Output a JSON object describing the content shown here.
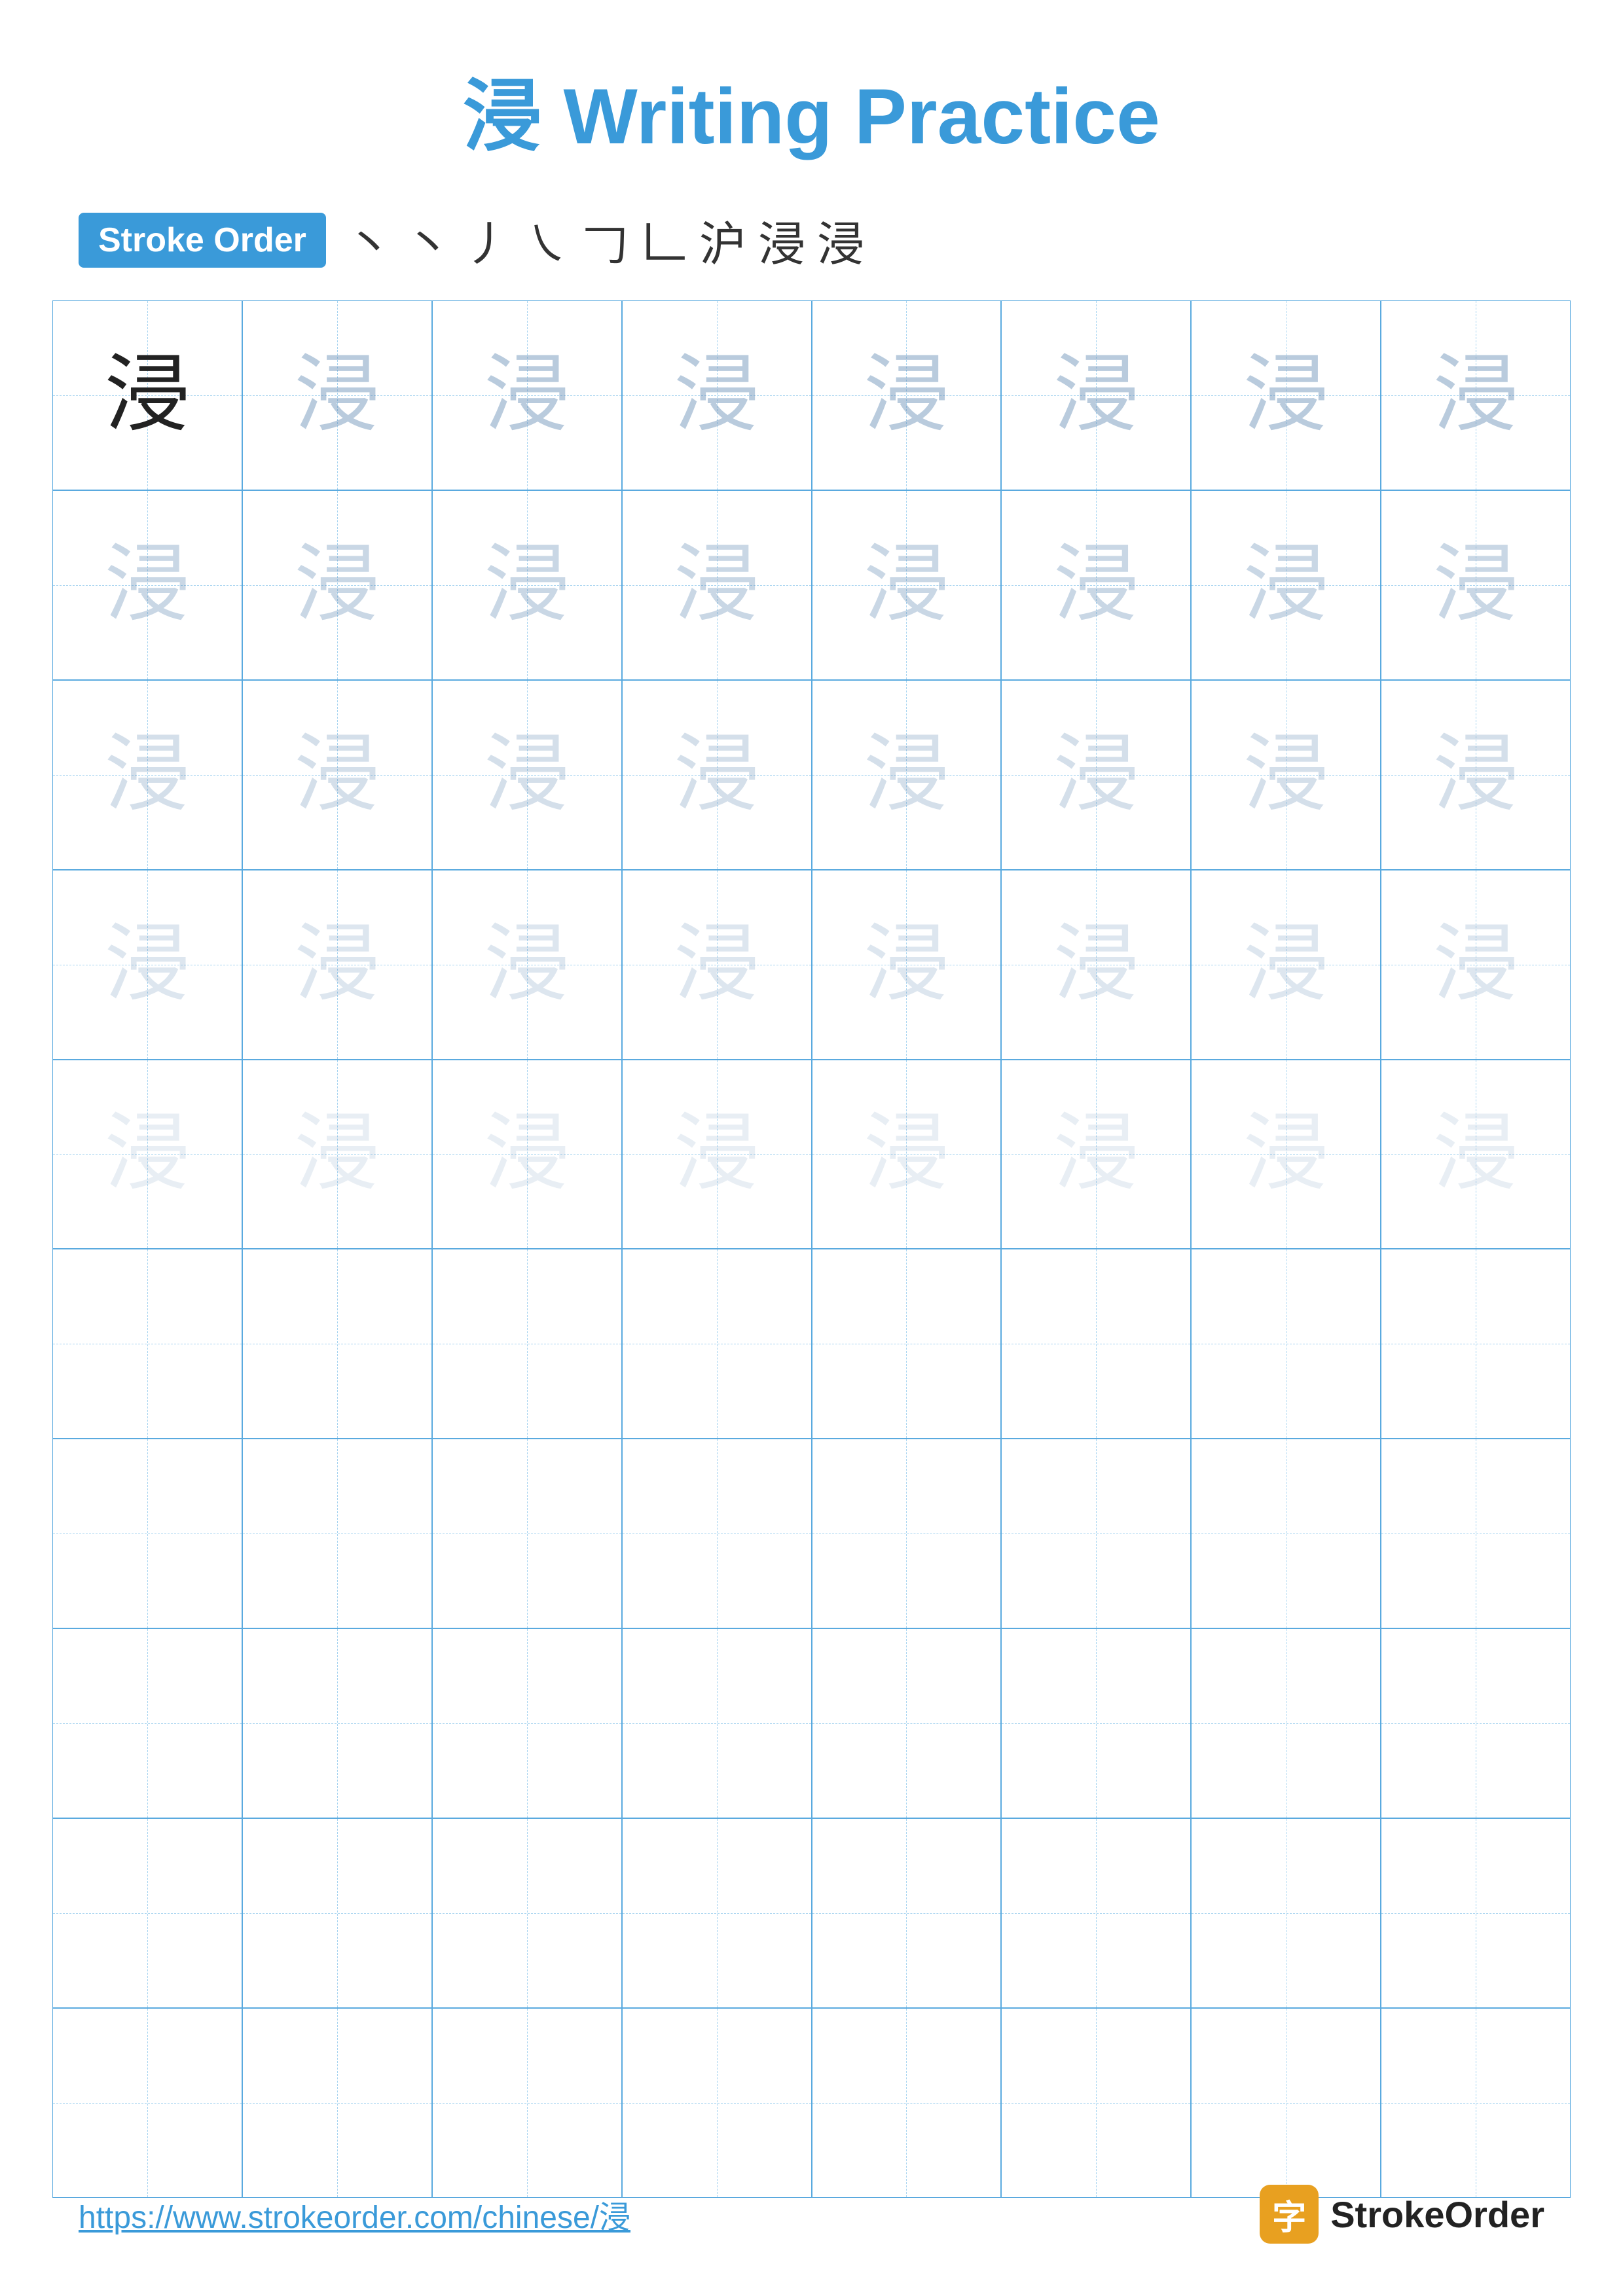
{
  "title": {
    "kanji": "浸",
    "text": " Writing Practice"
  },
  "stroke_order": {
    "badge": "Stroke Order",
    "strokes": [
      "丶",
      "丶",
      "丿",
      "㇏",
      "𠃌",
      "𠃊",
      "沪",
      "浸",
      "浸"
    ]
  },
  "grid": {
    "rows": 10,
    "cols": 8,
    "character": "浸",
    "guide_rows": 5,
    "empty_rows": 5
  },
  "footer": {
    "url": "https://www.strokeorder.com/chinese/浸",
    "logo_char": "字",
    "logo_text": "StrokeOrder"
  }
}
